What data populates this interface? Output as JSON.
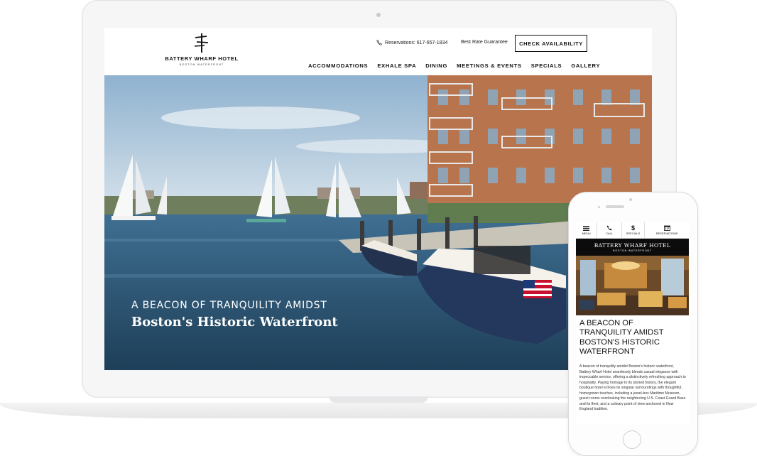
{
  "site": {
    "logo_name": "BATTERY WHARF HOTEL",
    "logo_sub": "BOSTON WATERFRONT",
    "reservations_phone": "Reservations: 617-657-1834",
    "best_rate": "Best Rate Guarantee",
    "cta": "CHECK AVAILABILITY",
    "nav": [
      "ACCOMMODATIONS",
      "EXHALE SPA",
      "DINING",
      "MEETINGS & EVENTS",
      "SPECIALS",
      "GALLERY"
    ],
    "hero_kicker": "A BEACON OF TRANQUILITY AMIDST",
    "hero_title": "Boston's Historic Waterfront"
  },
  "mobile": {
    "toolbar": [
      {
        "label": "MENU",
        "icon": "menu-icon"
      },
      {
        "label": "CALL",
        "icon": "phone-icon"
      },
      {
        "label": "SPECIALS",
        "icon": "dollar-icon"
      },
      {
        "label": "RESERVATIONS",
        "icon": "calendar-icon"
      }
    ],
    "banner_name": "BATTERY WHARF HOTEL",
    "banner_sub": "BOSTON WATERFRONT",
    "title": "A BEACON OF TRANQUILITY AMIDST BOSTON'S HISTORIC WATERFRONT",
    "body": "A beacon of tranquility amidst Boston's historic waterfront, Battery Wharf Hotel seamlessly blends casual elegance with impeccable service, offering a distinctively refreshing approach to hospitality. Paying homage to its storied history, the elegant boutique hotel echoes its singular surroundings with thoughtful, homegrown touches, including a jewel-box Maritime Museum, guest rooms overlooking the neighboring U.S. Coast Guard Base and its fleet, and a culinary point of view anchored in New England tradition."
  },
  "colors": {
    "header_bg": "#ffffff",
    "text_dark": "#111111",
    "banner_bg": "#0c0c0c",
    "water": "#2d5878",
    "brick": "#b8744c"
  }
}
